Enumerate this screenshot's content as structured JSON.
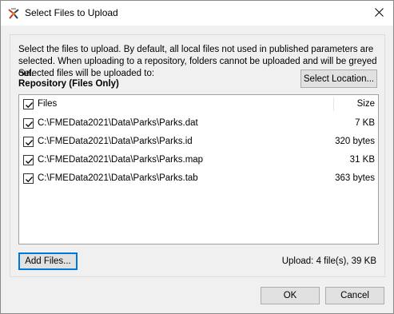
{
  "window": {
    "title": "Select Files to Upload",
    "app_icon": "fme-workbench-icon",
    "close_icon": "close-icon"
  },
  "dialog": {
    "description": "Select the files to upload. By default, all local files not used in published parameters are selected. When uploading to a repository, folders cannot be uploaded and will be greyed out.",
    "destination_label": "Selected files will be uploaded to:",
    "destination_value": "Repository (Files Only)",
    "select_location_label": "Select Location...",
    "add_files_label": "Add Files...",
    "upload_summary": "Upload: 4 file(s), 39 KB"
  },
  "file_list": {
    "header": {
      "name": "Files",
      "size": "Size",
      "checked": true
    },
    "rows": [
      {
        "name": "C:\\FMEData2021\\Data\\Parks\\Parks.dat",
        "size": "7 KB",
        "checked": true
      },
      {
        "name": "C:\\FMEData2021\\Data\\Parks\\Parks.id",
        "size": "320 bytes",
        "checked": true
      },
      {
        "name": "C:\\FMEData2021\\Data\\Parks\\Parks.map",
        "size": "31 KB",
        "checked": true
      },
      {
        "name": "C:\\FMEData2021\\Data\\Parks\\Parks.tab",
        "size": "363 bytes",
        "checked": true
      }
    ]
  },
  "footer": {
    "ok_label": "OK",
    "cancel_label": "Cancel"
  },
  "colors": {
    "focus_accent": "#0078d7",
    "dialog_bg": "#f0f0f0",
    "button_bg": "#e1e1e1"
  }
}
